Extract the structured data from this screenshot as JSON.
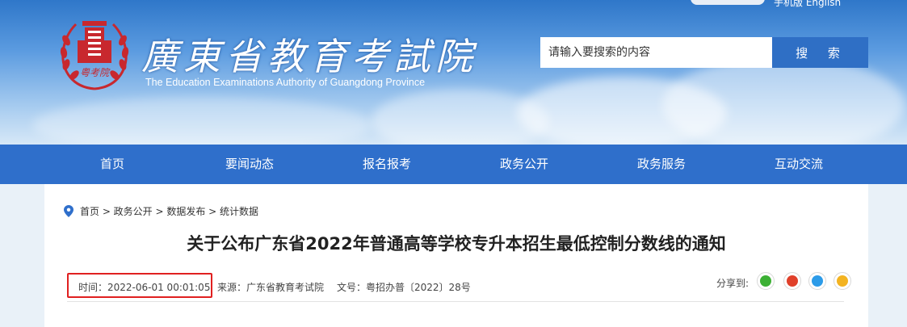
{
  "header": {
    "top_links": "手机版  English",
    "brand_cn": "廣東省教育考試院",
    "brand_en": "The Education Examinations Authority of Guangdong Province",
    "logo_text": "粤考院"
  },
  "search": {
    "placeholder": "请输入要搜索的内容",
    "button_label": "搜  索"
  },
  "nav": {
    "items": [
      "首页",
      "要闻动态",
      "报名报考",
      "政务公开",
      "政务服务",
      "互动交流"
    ]
  },
  "breadcrumb": "首页 > 政务公开 > 数据发布 > 统计数据",
  "article": {
    "title": "关于公布广东省2022年普通高等学校专升本招生最低控制分数线的通知",
    "time": "时间：2022-06-01 00:01:05",
    "source": "来源：广东省教育考试院",
    "doc_no": "文号：粤招办普〔2022〕28号",
    "share_label": "分享到:"
  },
  "share_icons": [
    "wechat-icon",
    "weibo-icon",
    "qq-icon",
    "qzone-icon"
  ],
  "colors": {
    "nav_bg": "#2f6fcb",
    "search_button": "#2f6fc5",
    "logo_red": "#c8282e",
    "highlight_box": "#e02020"
  }
}
